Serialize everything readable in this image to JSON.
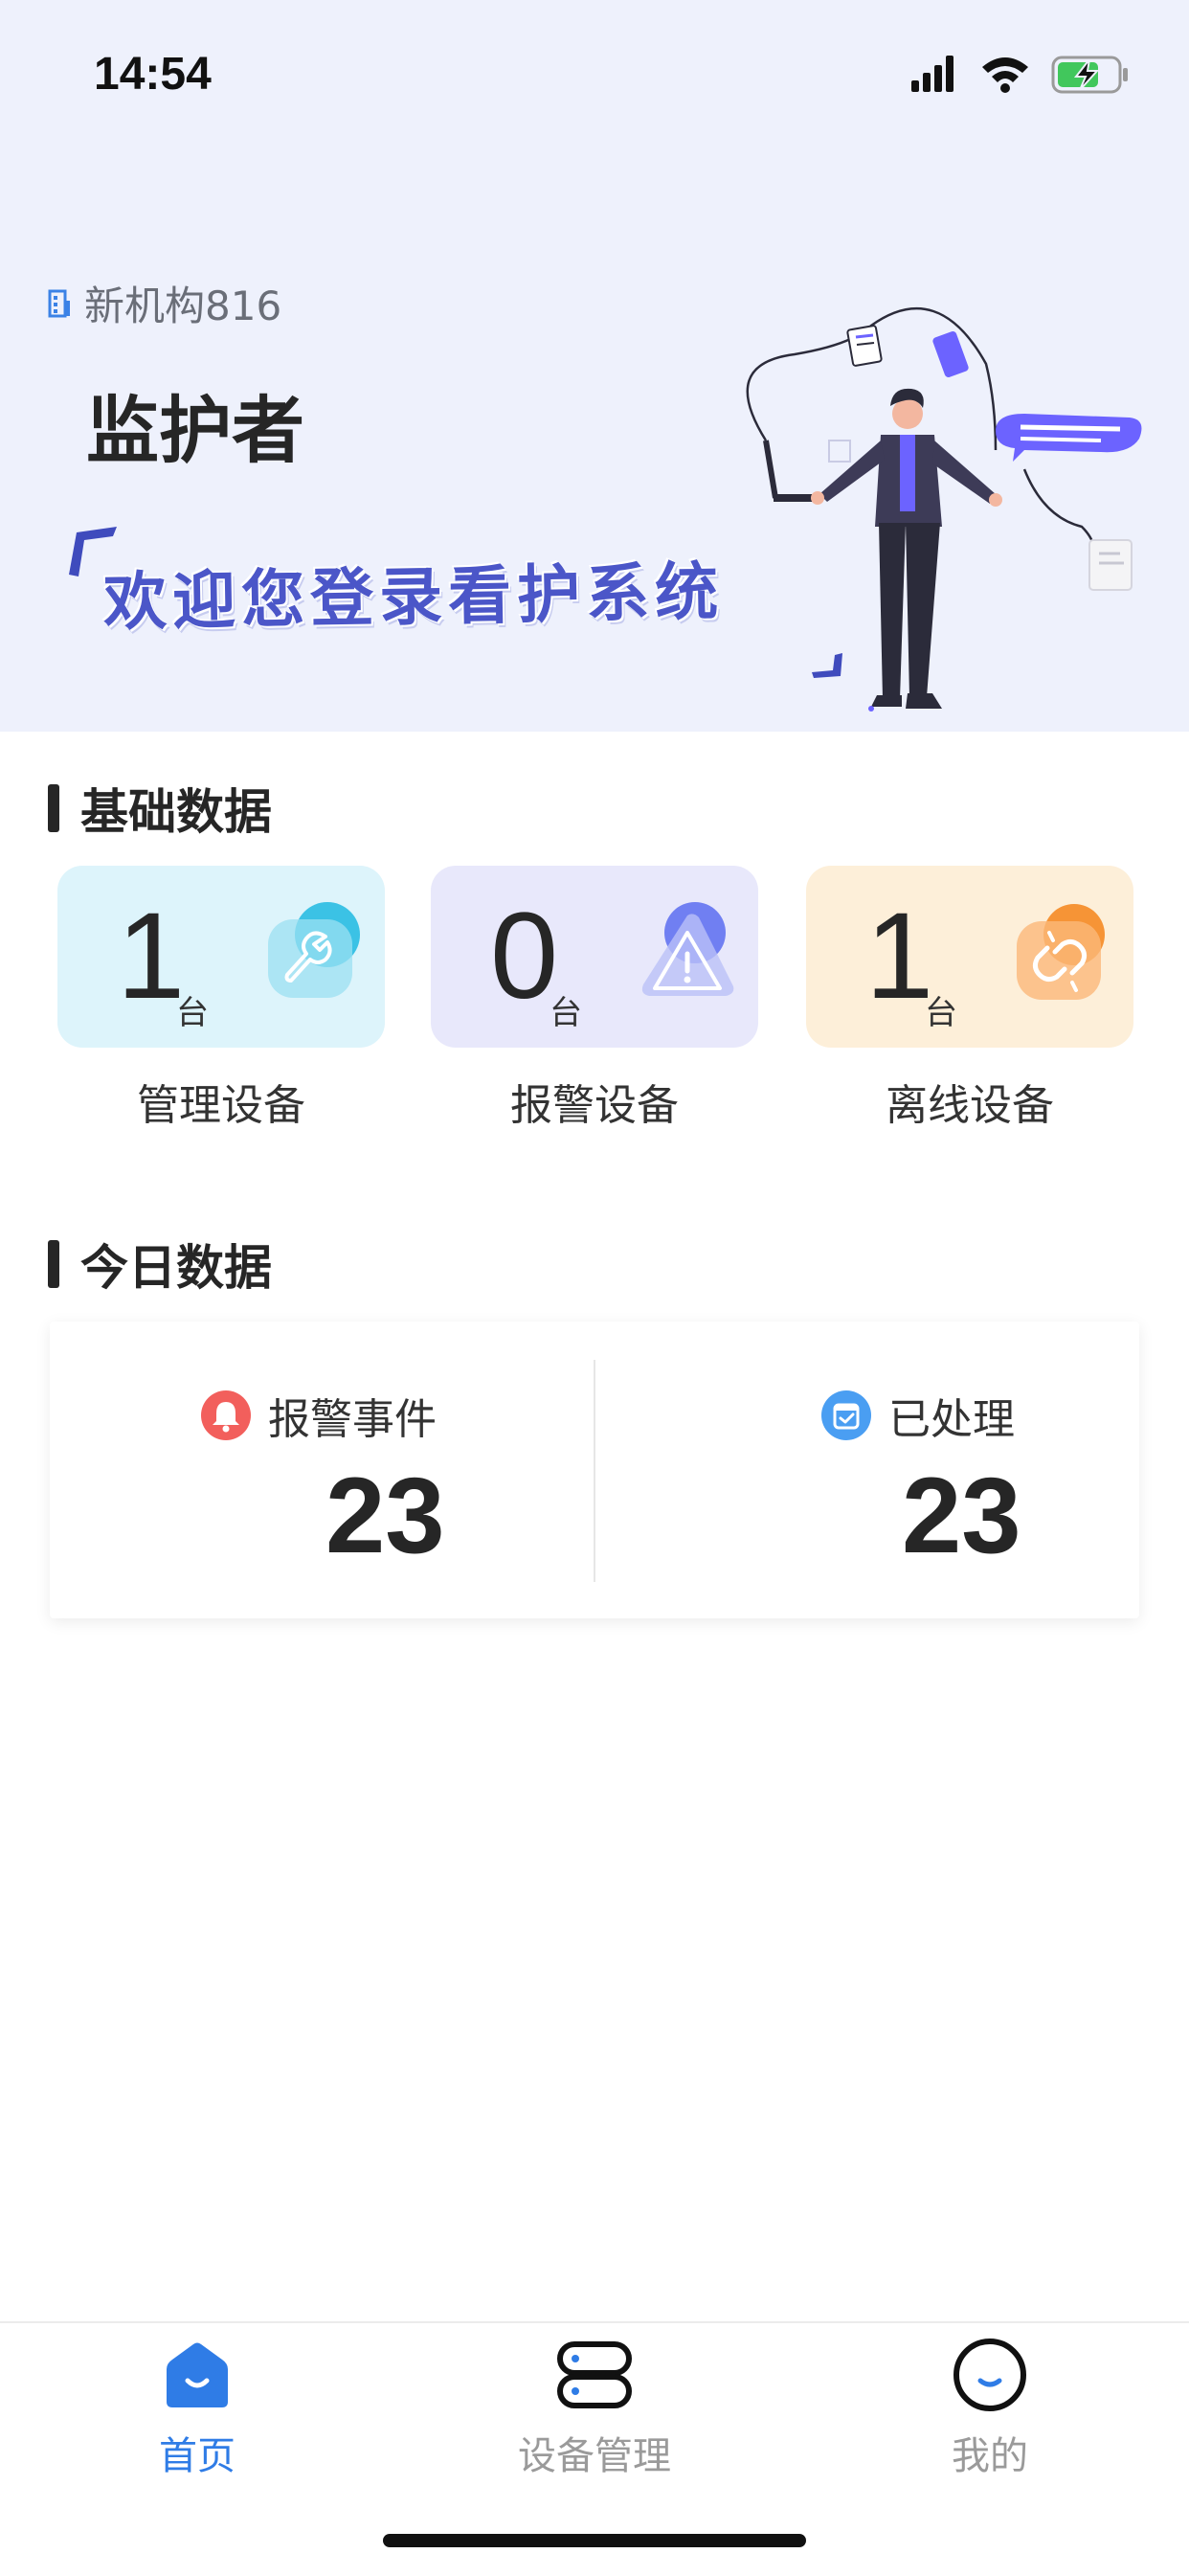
{
  "status_bar": {
    "time": "14:54",
    "icons": [
      "signal-icon",
      "wifi-icon",
      "battery-charging-icon"
    ]
  },
  "header": {
    "org_name": "新机构816",
    "role": "监护者",
    "welcome": "欢迎您登录看护系统"
  },
  "basic_data": {
    "title": "基础数据",
    "cards": [
      {
        "value": "1",
        "unit": "台",
        "label": "管理设备",
        "icon": "wrench-icon",
        "color": "#ddf4fb"
      },
      {
        "value": "0",
        "unit": "台",
        "label": "报警设备",
        "icon": "warning-icon",
        "color": "#e8e8fb"
      },
      {
        "value": "1",
        "unit": "台",
        "label": "离线设备",
        "icon": "broken-link-icon",
        "color": "#fdefd9"
      }
    ]
  },
  "today_data": {
    "title": "今日数据",
    "items": [
      {
        "label": "报警事件",
        "value": "23",
        "icon": "bell-icon"
      },
      {
        "label": "已处理",
        "value": "23",
        "icon": "calendar-check-icon"
      }
    ]
  },
  "tabbar": {
    "tabs": [
      {
        "label": "首页",
        "icon": "home-icon",
        "active": true
      },
      {
        "label": "设备管理",
        "icon": "device-management-icon",
        "active": false
      },
      {
        "label": "我的",
        "icon": "profile-icon",
        "active": false
      }
    ],
    "active_color": "#2f7ce6",
    "inactive_color": "#9a9a9a"
  }
}
